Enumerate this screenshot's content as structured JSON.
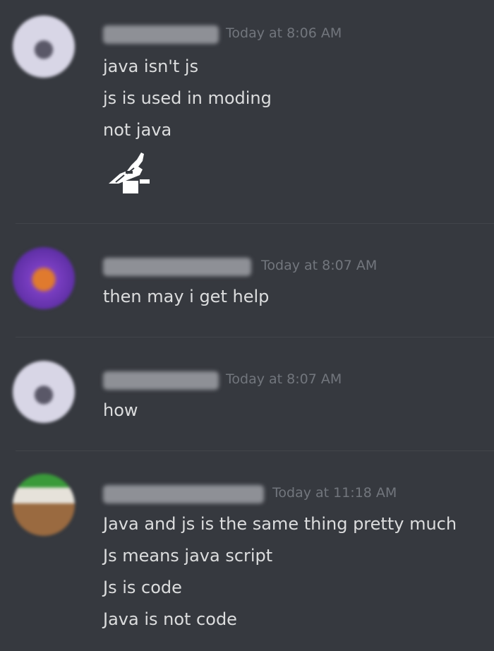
{
  "messages": [
    {
      "timestamp": "Today at 8:06 AM",
      "lines": [
        "java isn't js",
        "js is used in moding",
        "not java"
      ],
      "avatar_color": "#c8c6d8",
      "has_emoji": true
    },
    {
      "timestamp": "Today at 8:07 AM",
      "lines": [
        "then may i get help"
      ],
      "avatar_color": "#6a2fb0"
    },
    {
      "timestamp": "Today at 8:07 AM",
      "lines": [
        "how"
      ],
      "avatar_color": "#c8c6d8"
    },
    {
      "timestamp": "Today at 11:18 AM",
      "lines": [
        "Java and js is the same thing pretty much",
        "Js means java script",
        "Js is code",
        "Java is not code"
      ],
      "avatar_color": "#7a5a3a"
    }
  ],
  "colors": {
    "background": "#36393f",
    "timestamp": "#72767d",
    "text": "#dcddde",
    "divider": "#42454a"
  }
}
